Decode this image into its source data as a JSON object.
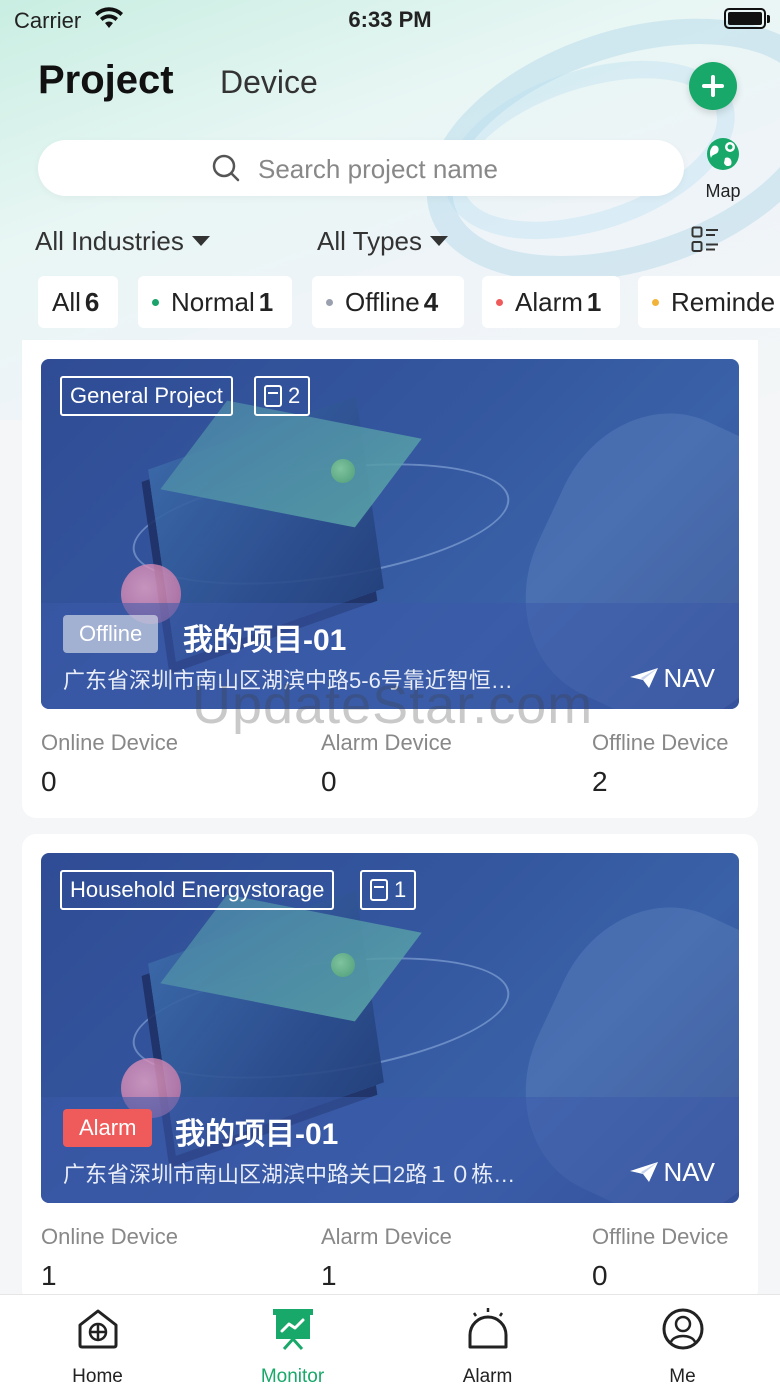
{
  "status_bar": {
    "carrier": "Carrier",
    "time": "6:33 PM"
  },
  "header": {
    "tab_project": "Project",
    "tab_device": "Device",
    "map_label": "Map"
  },
  "search": {
    "placeholder": "Search project name"
  },
  "filters": {
    "industry": "All Industries",
    "types": "All Types"
  },
  "chips": [
    {
      "label": "All",
      "count": "6",
      "color": ""
    },
    {
      "label": "Normal",
      "count": "1",
      "color": "#1aa36b"
    },
    {
      "label": "Offline",
      "count": "4",
      "color": "#9aa0b0"
    },
    {
      "label": "Alarm",
      "count": "1",
      "color": "#ef5b5b"
    },
    {
      "label": "Reminde",
      "count": "",
      "color": "#f2b33a"
    }
  ],
  "projects": [
    {
      "type_tag": "General Project",
      "device_count": "2",
      "status": "Offline",
      "name": "我的项目-01",
      "address": "广东省深圳市南山区湖滨中路5-6号靠近智恒…",
      "nav": "NAV",
      "online_label": "Online Device",
      "online": "0",
      "alarm_label": "Alarm Device",
      "alarm": "0",
      "offline_label": "Offline Device",
      "offline": "2"
    },
    {
      "type_tag": "Household Energystorage",
      "device_count": "1",
      "status": "Alarm",
      "name": "我的项目-01",
      "address": "广东省深圳市南山区湖滨中路关口2路１０栋…",
      "nav": "NAV",
      "online_label": "Online Device",
      "online": "1",
      "alarm_label": "Alarm Device",
      "alarm": "1",
      "offline_label": "Offline Device",
      "offline": "0"
    }
  ],
  "watermark": "UpdateStar.com",
  "tabbar": [
    {
      "label": "Home",
      "icon": "home-icon"
    },
    {
      "label": "Monitor",
      "icon": "monitor-icon"
    },
    {
      "label": "Alarm",
      "icon": "bell-icon"
    },
    {
      "label": "Me",
      "icon": "user-icon"
    }
  ],
  "colors": {
    "accent": "#18a869",
    "alarm": "#ef5b5b",
    "banner": "#2f4c95"
  }
}
